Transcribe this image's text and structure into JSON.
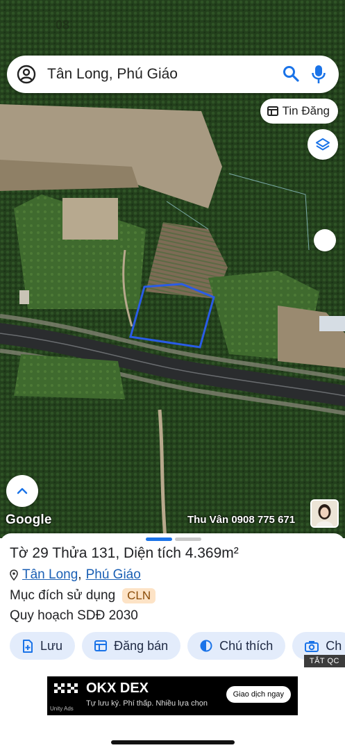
{
  "status": {
    "time": "08",
    "signal": "⋯"
  },
  "search": {
    "query": "Tân Long, Phú Giáo"
  },
  "map": {
    "tin_dang_label": "Tin Đăng",
    "attribution": "Google",
    "watermark": "Thu Vân 0908 775 671"
  },
  "sheet": {
    "parcel_title": "Tờ 29 Thửa 131, Diện tích 4.369m²",
    "location_ward": "Tân Long",
    "location_sep": ",",
    "location_district": "Phú Giáo",
    "purpose_label": "Mục đích sử dụng",
    "purpose_code": "CLN",
    "plan_label": "Quy hoạch SDĐ 2030",
    "actions": [
      {
        "label": "Lưu",
        "icon": "save-icon"
      },
      {
        "label": "Đăng bán",
        "icon": "listing-icon"
      },
      {
        "label": "Chú thích",
        "icon": "legend-icon"
      },
      {
        "label": "Ch",
        "icon": "camera-icon"
      }
    ],
    "hide_ads_label": "TẮT QC"
  },
  "ad": {
    "title": "OKX DEX",
    "subtitle": "Tự lưu ký. Phí thấp. Nhiều lựa chọn",
    "cta": "Giao dịch ngay",
    "network": "Unity Ads"
  },
  "colors": {
    "accent": "#1a73e8",
    "parcel_outline": "#2a5ce6",
    "chip_bg": "#e3ecfb"
  }
}
